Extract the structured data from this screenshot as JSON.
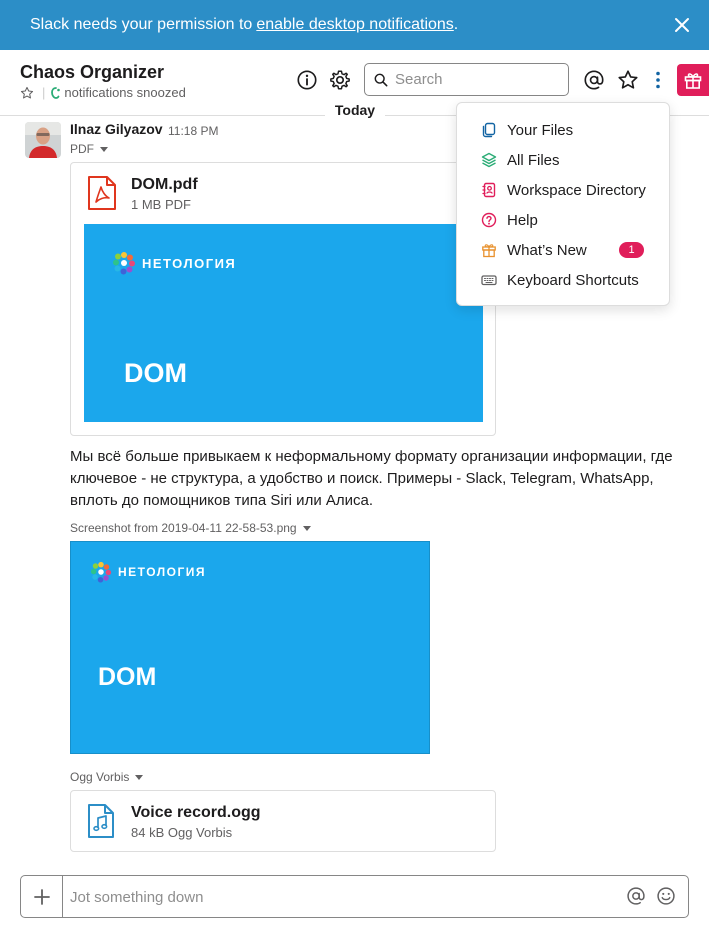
{
  "banner": {
    "text": "Slack needs your permission to",
    "link": "enable desktop notifications",
    "suffix": "."
  },
  "header": {
    "channel_name": "Chaos Organizer",
    "status": "notifications snoozed",
    "search_placeholder": "Search"
  },
  "divider_label": "Today",
  "message": {
    "author": "Ilnaz Gilyazov",
    "time": "11:18 PM",
    "file_type_label": "PDF",
    "pdf": {
      "name": "DOM.pdf",
      "meta": "1 MB PDF",
      "preview_brand": "НЕТОЛОГИЯ",
      "preview_title": "DOM"
    },
    "text": "Мы всё больше привыкаем к неформальному формату организации информации, где ключевое - не структура, а удобство и поиск. Примеры - Slack, Telegram, WhatsApp, вплоть до помощников типа Siri или Алиса.",
    "screenshot": {
      "name": "Screenshot from 2019-04-11 22-58-53.png",
      "preview_brand": "НЕТОЛОГИЯ",
      "preview_title": "DOM"
    },
    "audio_type_label": "Ogg Vorbis",
    "audio": {
      "name": "Voice record.ogg",
      "meta": "84 kB Ogg Vorbis"
    }
  },
  "composer": {
    "placeholder": "Jot something down"
  },
  "menu": {
    "items": [
      {
        "label": "Your Files",
        "icon": "files-icon"
      },
      {
        "label": "All Files",
        "icon": "layers-icon"
      },
      {
        "label": "Workspace Directory",
        "icon": "directory-icon"
      },
      {
        "label": "Help",
        "icon": "help-icon"
      },
      {
        "label": "What’s New",
        "icon": "gift-icon",
        "badge": "1"
      },
      {
        "label": "Keyboard Shortcuts",
        "icon": "keyboard-icon"
      }
    ]
  },
  "colors": {
    "banner": "#2c8ec7",
    "accent": "#e01e5a",
    "preview_blue": "#1ba7ec",
    "pdf_red": "#e0361e",
    "audio_blue": "#2c8ec7"
  }
}
